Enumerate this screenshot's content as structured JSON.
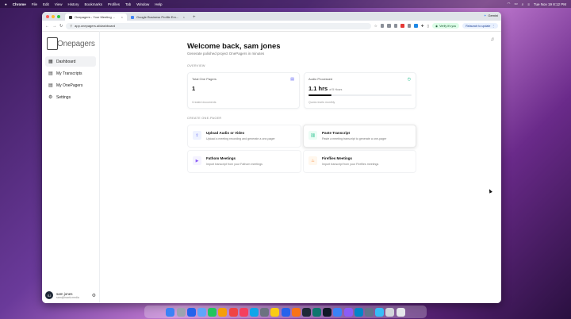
{
  "menubar": {
    "app": "Chrome",
    "items": [
      "File",
      "Edit",
      "View",
      "History",
      "Bookmarks",
      "Profiles",
      "Tab",
      "Window",
      "Help"
    ],
    "clock": "Tue Nov 19  8:12 PM"
  },
  "browser": {
    "tabs": [
      {
        "label": "Onepagers - Your Meeting ...",
        "favicon_color": "#ffffff"
      },
      {
        "label": "Google Business Profile Em...",
        "favicon_color": "#4285f4"
      }
    ],
    "new_tab_glyph": "+",
    "gemini_label": "Gemini",
    "url": "app.onepagers.ai/dashboard",
    "verify_label": "Verify it's you",
    "relaunch_label": "Relaunch to update"
  },
  "sidebar": {
    "logo_text": "Onepagers",
    "items": [
      {
        "label": "Dashboard",
        "icon": "dashboard-icon",
        "glyph": "▦"
      },
      {
        "label": "My Transcripts",
        "icon": "document-icon",
        "glyph": "▤"
      },
      {
        "label": "My OnePagers",
        "icon": "file-icon",
        "glyph": "▤"
      },
      {
        "label": "Settings",
        "icon": "gear-icon",
        "glyph": "⚙"
      }
    ],
    "user": {
      "initials": "SJ",
      "name": "sam jones",
      "email": "sam@hawk.media"
    }
  },
  "main": {
    "title": "Welcome back, sam jones",
    "subtitle": "Generate polished project OnePagers in minutes",
    "overview_label": "OVERVIEW",
    "stats": [
      {
        "label": "Total One Pagers",
        "value": "1",
        "caption": "Created documents",
        "icon": "document-icon"
      },
      {
        "label": "Audio Processed",
        "value": "1.1 hrs",
        "suffix": "of 5 Hours",
        "caption": "Quota resets monthly",
        "icon": "clock-icon",
        "progress": 0.22
      }
    ],
    "create_label": "CREATE ONE-PAGER",
    "actions": [
      {
        "title": "Upload Audio or Video",
        "desc": "Upload a meeting recording and generate a one-pager",
        "icon": "upload-icon",
        "glyph": "⇪",
        "bg": "#eef2ff",
        "fg": "#6366f1"
      },
      {
        "title": "Paste Transcript",
        "desc": "Paste a meeting transcript to generate a one-pager",
        "icon": "link-icon",
        "glyph": "⛓",
        "bg": "#ecfdf5",
        "fg": "#10b981"
      },
      {
        "title": "Fathom Meetings",
        "desc": "Import transcript from your Fathom meetings",
        "icon": "video-icon",
        "glyph": "▶",
        "bg": "#f5f3ff",
        "fg": "#8b5cf6"
      },
      {
        "title": "Fireflies Meetings",
        "desc": "Import transcript from your Fireflies meetings",
        "icon": "fire-icon",
        "glyph": "♨",
        "bg": "#fff7ed",
        "fg": "#f97316"
      }
    ]
  },
  "colors": {
    "accent": "#111111",
    "verify_bg": "#dcfce7",
    "relaunch_bg": "#e8f0fe"
  }
}
